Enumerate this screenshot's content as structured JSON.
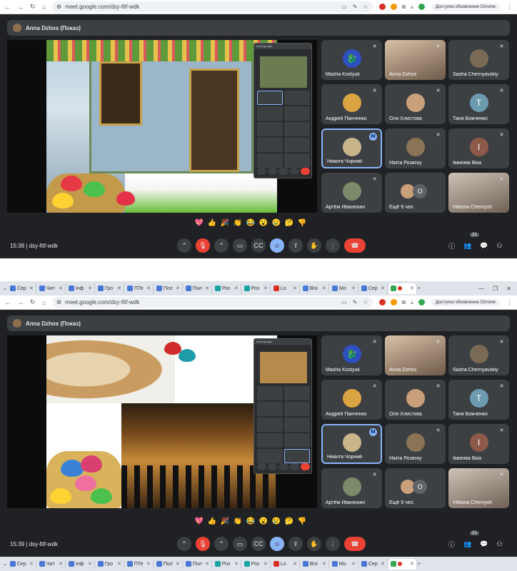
{
  "url": "meet.google.com/dsy-fitf-wdk",
  "update_label": "Доступно обновление Chrome",
  "presenter_label": "Anna Dzhos (Показ)",
  "meeting_code": "dsy-fitf-wdk",
  "times": [
    "15:38",
    "15:39"
  ],
  "participant_count": "21",
  "tabs": [
    {
      "label": "Сер"
    },
    {
      "label": "Чит"
    },
    {
      "label": "Інф"
    },
    {
      "label": "Гро"
    },
    {
      "label": "ПТе"
    },
    {
      "label": "Пол"
    },
    {
      "label": "Пол"
    },
    {
      "label": "Роз"
    },
    {
      "label": "Роз"
    },
    {
      "label": "Lo"
    },
    {
      "label": "Візі"
    },
    {
      "label": "Мо"
    },
    {
      "label": "Сер"
    }
  ],
  "participants": [
    {
      "name": "Masha Kostyuk",
      "avatar": "blue-dragon",
      "color": "#2d4fbf",
      "state": "muted"
    },
    {
      "name": "Anna Dzhos",
      "avatar": "video",
      "color": "#b58d72",
      "state": "muted"
    },
    {
      "name": "Sasha Chernyavskiy",
      "avatar": "photo",
      "color": "#7a6a55",
      "state": "muted"
    },
    {
      "name": "Андрей Панченко",
      "avatar": "photo",
      "color": "#d9a441",
      "state": "muted"
    },
    {
      "name": "Оля Хлистова",
      "avatar": "photo",
      "color": "#c9a07a",
      "state": "muted"
    },
    {
      "name": "Таня Божченко",
      "avatar": "letter",
      "letter": "Т",
      "color": "#6c9bb0",
      "state": "muted"
    },
    {
      "name": "Никита Чорний",
      "avatar": "photo",
      "color": "#c8b48a",
      "state": "speaking"
    },
    {
      "name": "Нікіта Розиску",
      "avatar": "photo",
      "color": "#8b7355",
      "state": "muted"
    },
    {
      "name": "Іванова Віка",
      "avatar": "letter",
      "letter": "І",
      "color": "#8d5a4a",
      "state": "muted"
    },
    {
      "name": "Артём Иванюхин",
      "avatar": "photo",
      "color": "#7d8a6a",
      "state": "muted"
    },
    {
      "name": "Ещё 9 чел.",
      "avatar": "group",
      "letter": "О",
      "color": "#c9a07a",
      "state": "none"
    },
    {
      "name": "Viktoria Chernysh",
      "avatar": "video",
      "color": "#8a7868",
      "state": "muted"
    }
  ],
  "reactions": [
    "💖",
    "👍",
    "🎉",
    "👏",
    "😂",
    "😮",
    "😢",
    "🤔",
    "👎"
  ],
  "colors": {
    "accent": "#8ab4f8",
    "hangup": "#ea4335",
    "bg": "#202124",
    "tile": "#3c4043"
  }
}
